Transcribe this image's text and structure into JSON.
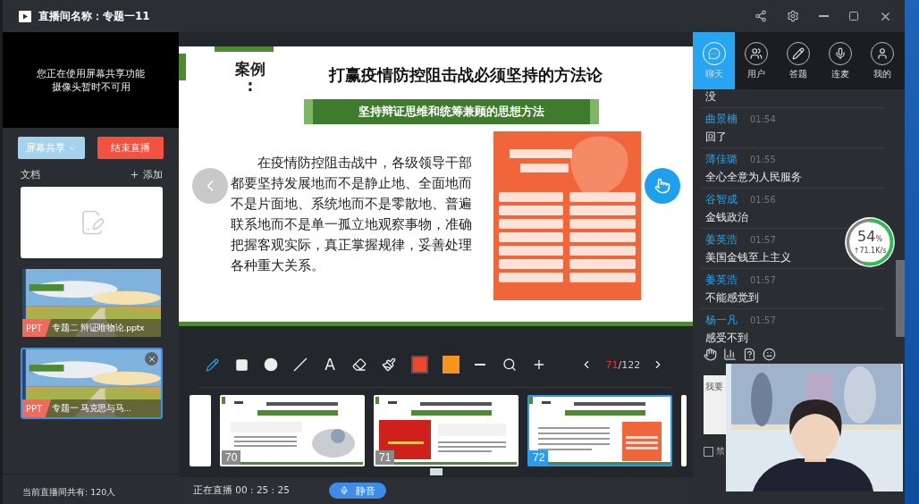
{
  "window": {
    "title": "直播间名称：专题一11"
  },
  "camera": {
    "notice_lines": [
      "您正在使用屏幕共享功能",
      "摄像头暂时不可用"
    ]
  },
  "left_buttons": [
    {
      "label": "屏幕共享",
      "kind": "dropdown"
    },
    {
      "label": "结束直播",
      "kind": "danger"
    }
  ],
  "documents": {
    "title": "文档",
    "add": "添加",
    "items": [
      {
        "kind": "empty"
      },
      {
        "kind": "ppt",
        "tag": "PPT",
        "name": "专题二  辩证唯物论.pptx",
        "selected": false
      },
      {
        "kind": "ppt",
        "tag": "PPT",
        "name": "专题一  马克思与马...",
        "selected": true
      }
    ]
  },
  "viewer_count": "当前直播间共有: 120人",
  "slide": {
    "label": "案例",
    "colon": ":",
    "title": "打赢疫情防控阻击战必须坚持的方法论",
    "subtitle": "坚持辩证思维和统筹兼顾的思想方法",
    "body": "在疫情防控阻击战中，各级领导干部都要坚持发展地而不是静止地、全面地而不是片面地、系统地而不是零散地、普遍联系地而不是单一孤立地观察事物，准确把握客观实际，真正掌握规律，妥善处理各种重大关系。"
  },
  "tools": [
    {
      "kind": "pencil",
      "selected": true
    },
    {
      "kind": "rectangle",
      "selected": false
    },
    {
      "kind": "circle",
      "selected": false
    },
    {
      "kind": "line",
      "selected": false
    },
    {
      "kind": "text",
      "label": "A",
      "selected": false
    },
    {
      "kind": "eraser",
      "selected": false
    },
    {
      "kind": "brush",
      "selected": false
    },
    {
      "kind": "color",
      "color": "#f0452f",
      "selected": true
    },
    {
      "kind": "color",
      "color": "#f7941d",
      "selected": false
    }
  ],
  "pager": {
    "current": "71",
    "rest": "/122"
  },
  "thumbnails": [
    {
      "number": "70",
      "kind": "illustration",
      "selected": false
    },
    {
      "number": "71",
      "selected": false
    },
    {
      "number": "72",
      "kind": "poster",
      "selected": true
    }
  ],
  "status": {
    "label": "正在直播",
    "time": "00 : 25 : 25",
    "mute": "静音"
  },
  "chat_tabs": [
    {
      "label": "聊天",
      "kind": "chat",
      "selected": true
    },
    {
      "label": "用户",
      "kind": "users",
      "selected": false
    },
    {
      "label": "答题",
      "kind": "quiz",
      "selected": false
    },
    {
      "label": "连麦",
      "kind": "mic",
      "selected": false
    },
    {
      "label": "我的",
      "kind": "me",
      "selected": false
    }
  ],
  "messages": [
    {
      "text": "没"
    },
    {
      "name": "曲景楠",
      "time": "01:54",
      "text": "回了"
    },
    {
      "name": "薄佳璐",
      "time": "01:55",
      "text": "全心全意为人民服务"
    },
    {
      "name": "谷智成",
      "time": "01:56",
      "text": "金钱政治"
    },
    {
      "name": "姜英浩",
      "time": "01:57",
      "text": "美国金钱至上主义"
    },
    {
      "name": "姜英浩",
      "time": "01:57",
      "text": "不能感觉到"
    },
    {
      "name": "杨一凡",
      "time": "01:57",
      "text": "感受不到"
    }
  ],
  "network": {
    "level": 0.54,
    "value": "54",
    "unit": "%",
    "speed": "↑71.1K/s"
  },
  "chat_input": {
    "placeholder": "我要"
  },
  "option": {
    "label": "禁",
    "checked": false
  }
}
